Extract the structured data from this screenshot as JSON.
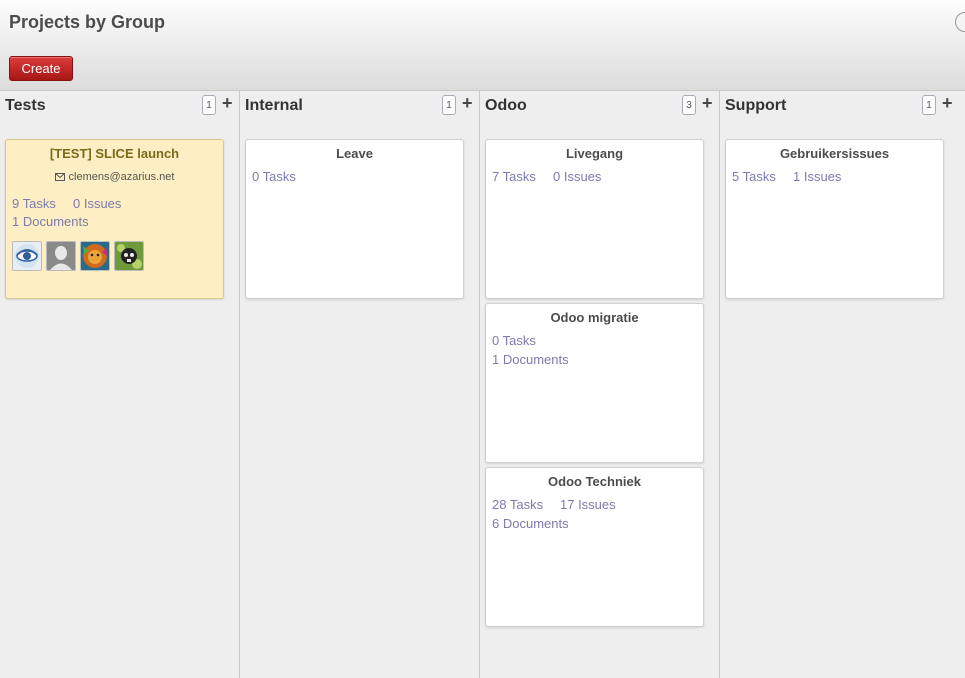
{
  "page": {
    "title": "Projects by Group"
  },
  "toolbar": {
    "create_label": "Create"
  },
  "columns": [
    {
      "title": "Tests",
      "count": "1",
      "add_label": "+",
      "cards": [
        {
          "title": "[TEST] SLICE launch",
          "email": "clemens@azarius.net",
          "tasks": "9 Tasks",
          "issues": "0 Issues",
          "documents": "1 Documents",
          "avatars": [
            "eye-avatar",
            "default-avatar",
            "lion-avatar",
            "skull-avatar"
          ]
        }
      ]
    },
    {
      "title": "Internal",
      "count": "1",
      "add_label": "+",
      "cards": [
        {
          "title": "Leave",
          "tasks": "0 Tasks"
        }
      ]
    },
    {
      "title": "Odoo",
      "count": "3",
      "add_label": "+",
      "cards": [
        {
          "title": "Livegang",
          "tasks": "7 Tasks",
          "issues": "0 Issues"
        },
        {
          "title": "Odoo migratie",
          "tasks": "0 Tasks",
          "documents": "1 Documents"
        },
        {
          "title": "Odoo Techniek",
          "tasks": "28 Tasks",
          "issues": "17 Issues",
          "documents": "6 Documents"
        }
      ]
    },
    {
      "title": "Support",
      "count": "1",
      "add_label": "+",
      "cards": [
        {
          "title": "Gebruikersissues",
          "tasks": "5 Tasks",
          "issues": "1 Issues"
        }
      ]
    }
  ],
  "colors": {
    "header_bg": "#e8e8e8",
    "create_button": "#c12727",
    "link": "#7c7bad",
    "highlight_card": "#fdefc3"
  }
}
